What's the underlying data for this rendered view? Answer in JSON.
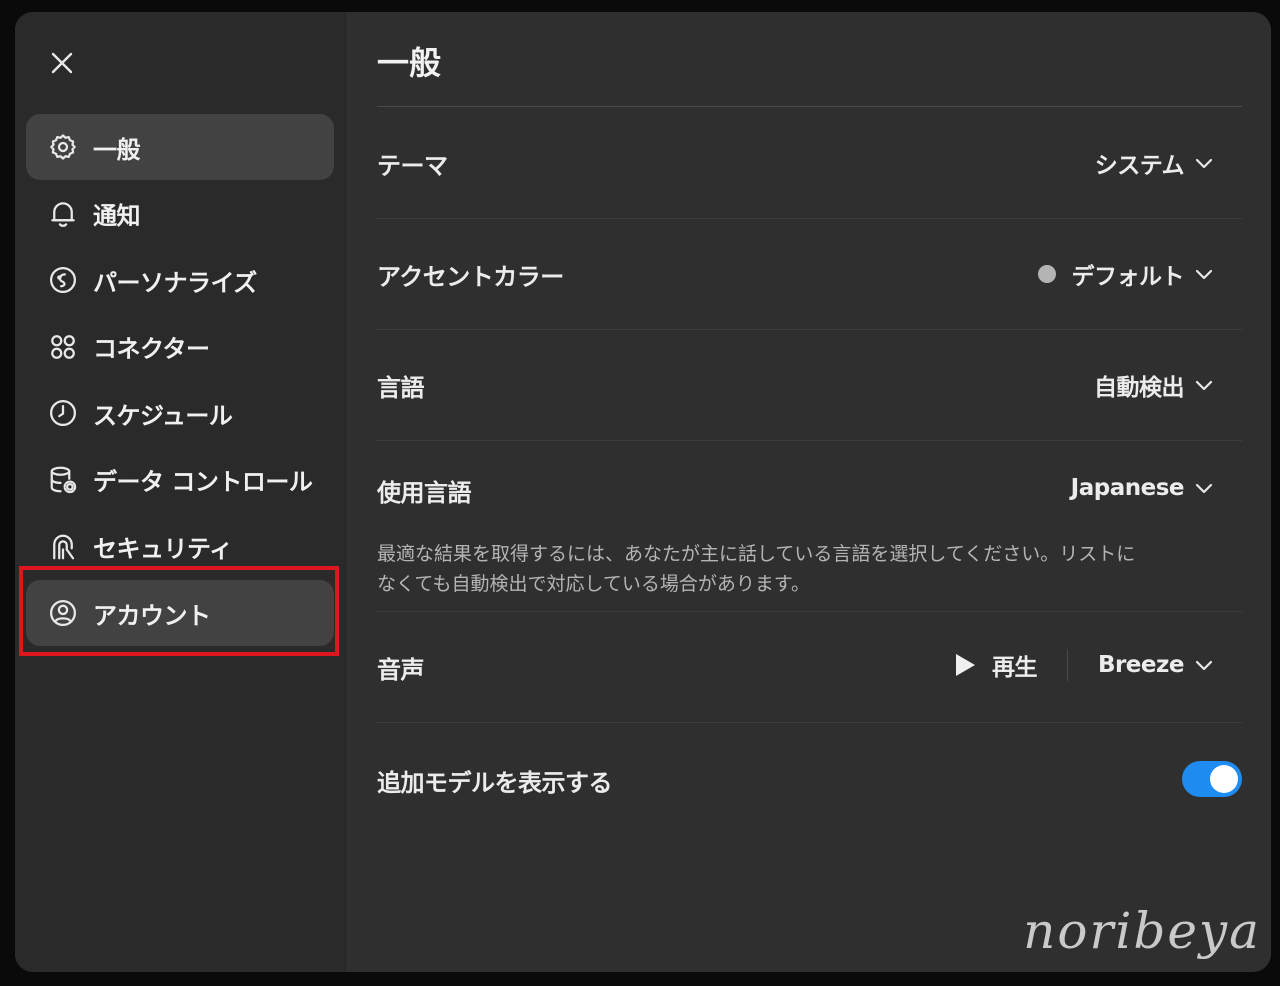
{
  "sidebar": {
    "items": [
      {
        "label": "一般",
        "icon": "gear-icon",
        "active": true
      },
      {
        "label": "通知",
        "icon": "bell-icon",
        "active": false
      },
      {
        "label": "パーソナライズ",
        "icon": "personalize-icon",
        "active": false
      },
      {
        "label": "コネクター",
        "icon": "connector-icon",
        "active": false
      },
      {
        "label": "スケジュール",
        "icon": "clock-icon",
        "active": false
      },
      {
        "label": "データ コントロール",
        "icon": "database-gear-icon",
        "active": false
      },
      {
        "label": "セキュリティ",
        "icon": "security-icon",
        "active": false
      },
      {
        "label": "アカウント",
        "icon": "user-circle-icon",
        "active": true
      }
    ],
    "highlight_color": "#e0161e"
  },
  "main": {
    "title": "一般",
    "theme": {
      "label": "テーマ",
      "value": "システム"
    },
    "accent": {
      "label": "アクセントカラー",
      "value": "デフォルト",
      "dot_color": "#b4b4b4"
    },
    "language": {
      "label": "言語",
      "value": "自動検出"
    },
    "spoken_language": {
      "label": "使用言語",
      "value": "Japanese",
      "description_line1": "最適な結果を取得するには、あなたが主に話している言語を選択してください。リストに",
      "description_line2": "なくても自動検出で対応している場合があります。"
    },
    "voice": {
      "label": "音声",
      "play_label": "再生",
      "value": "Breeze"
    },
    "additional_models": {
      "label": "追加モデルを表示する",
      "enabled": true,
      "toggle_color": "#1e8cf0"
    }
  },
  "watermark": "noribeya"
}
